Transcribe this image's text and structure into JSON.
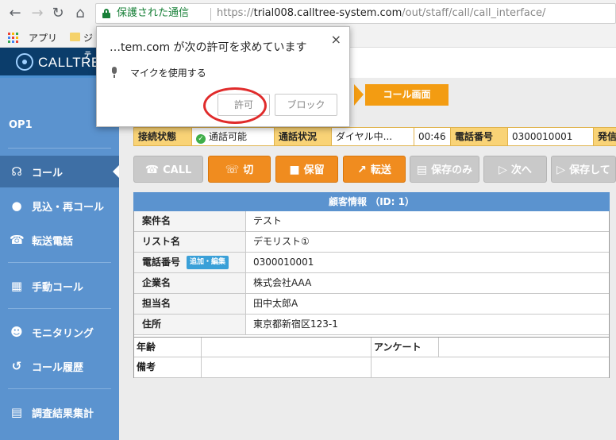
{
  "browser": {
    "secure_label": "保護された通信",
    "url_scheme": "https://",
    "url_host": "trial008.calltree-system.com",
    "url_path": "/out/staff/call/call_interface/",
    "bookmarks": {
      "apps_label": "アプリ",
      "folder_label": "ジ"
    }
  },
  "app": {
    "logo_text": "CALLTREE",
    "logo_small": "テ",
    "operator": "OP1"
  },
  "sidebar": {
    "items": [
      {
        "label": "コール",
        "icon": "headset-icon",
        "active": true
      },
      {
        "label": "見込・再コール",
        "icon": "recall-icon"
      },
      {
        "label": "転送電話",
        "icon": "transfer-phone-icon"
      },
      {
        "label": "手動コール",
        "icon": "keypad-icon"
      },
      {
        "label": "モニタリング",
        "icon": "monitoring-icon"
      },
      {
        "label": "コール履歴",
        "icon": "history-icon"
      },
      {
        "label": "調査結果集計",
        "icon": "clipboard-icon"
      }
    ]
  },
  "flow": {
    "step_label": "コール画面"
  },
  "status": {
    "conn_label": "接続状態",
    "conn_value": "通話可能",
    "call_label": "通話状況",
    "call_value": "ダイヤル中...",
    "timer": "00:46",
    "phone_label": "電話番号",
    "phone_value": "0300010001",
    "caller_label": "発信"
  },
  "buttons": {
    "call": "CALL",
    "hangup": "切",
    "hold": "保留",
    "transfer": "転送",
    "save_only": "保存のみ",
    "next": "次へ",
    "save_and": "保存して"
  },
  "customer": {
    "title": "顧客情報 （ID: 1）",
    "rows": [
      {
        "key": "案件名",
        "value": "テスト"
      },
      {
        "key": "リスト名",
        "value": "デモリスト①"
      },
      {
        "key": "電話番号",
        "value": "0300010001",
        "badge": "追加・編集"
      },
      {
        "key": "企業名",
        "value": "株式会社AAA"
      },
      {
        "key": "担当名",
        "value": "田中太郎A"
      },
      {
        "key": "住所",
        "value": "東京都新宿区123-1"
      }
    ],
    "extra": {
      "age_label": "年齢",
      "survey_label": "アンケート",
      "notes_label": "備考"
    }
  },
  "permission_popup": {
    "title": "…tem.com が次の許可を求めています",
    "request_text": "マイクを使用する",
    "allow_label": "許可",
    "block_label": "ブロック",
    "close_symbol": "×"
  },
  "colors": {
    "accent_orange": "#f08c1f",
    "sidebar_blue": "#5b93cf",
    "highlight_red": "#e02b2b"
  }
}
